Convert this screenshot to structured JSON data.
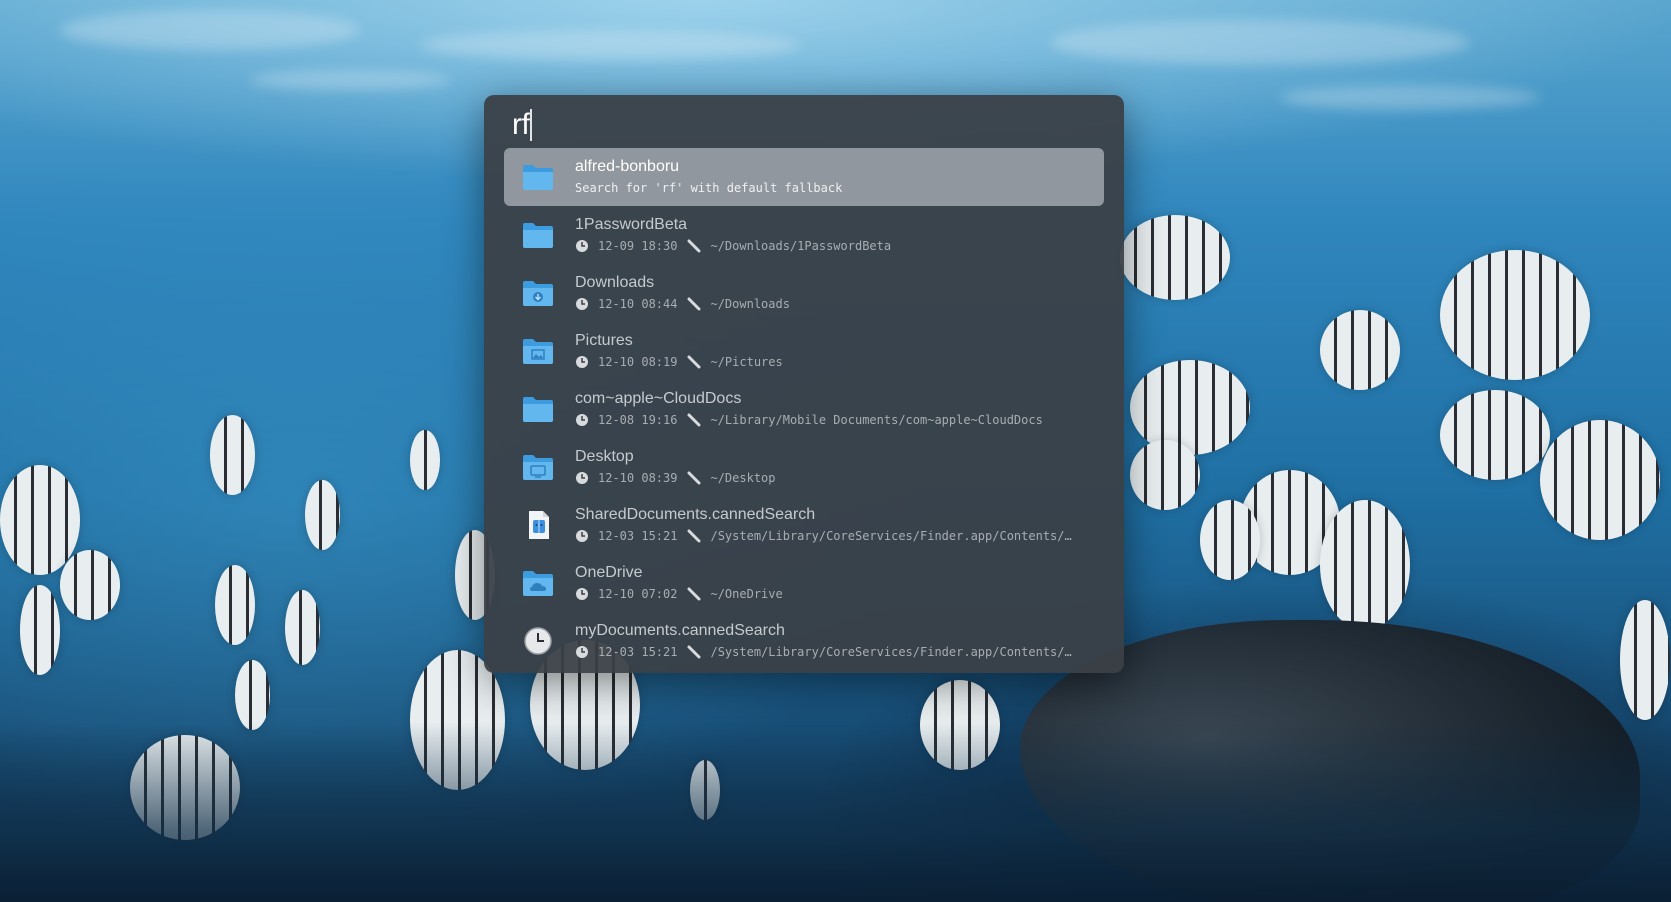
{
  "search": {
    "query": "rf"
  },
  "results": [
    {
      "icon": "folder-icon",
      "title": "alfred-bonboru",
      "subtitle": "Search for 'rf' with default fallback",
      "selected": true
    },
    {
      "icon": "folder-icon",
      "title": "1PasswordBeta",
      "time": "12-09 18:30",
      "path": "~/Downloads/1PasswordBeta"
    },
    {
      "icon": "downloads-folder-icon",
      "title": "Downloads",
      "time": "12-10 08:44",
      "path": "~/Downloads"
    },
    {
      "icon": "pictures-folder-icon",
      "title": "Pictures",
      "time": "12-10 08:19",
      "path": "~/Pictures"
    },
    {
      "icon": "folder-icon",
      "title": "com~apple~CloudDocs",
      "time": "12-08 19:16",
      "path": "~/Library/Mobile Documents/com~apple~CloudDocs"
    },
    {
      "icon": "desktop-folder-icon",
      "title": "Desktop",
      "time": "12-10 08:39",
      "path": "~/Desktop"
    },
    {
      "icon": "finder-document-icon",
      "title": "SharedDocuments.cannedSearch",
      "time": "12-03 15:21",
      "path": "/System/Library/CoreServices/Finder.app/Contents/…"
    },
    {
      "icon": "onedrive-folder-icon",
      "title": "OneDrive",
      "time": "12-10 07:02",
      "path": "~/OneDrive"
    },
    {
      "icon": "recents-clock-icon",
      "title": "myDocuments.cannedSearch",
      "time": "12-03 15:21",
      "path": "/System/Library/CoreServices/Finder.app/Contents/…"
    }
  ],
  "colors": {
    "folder": "#58b4e8",
    "selected_row": "#969ca2",
    "window": "#3a4046"
  }
}
